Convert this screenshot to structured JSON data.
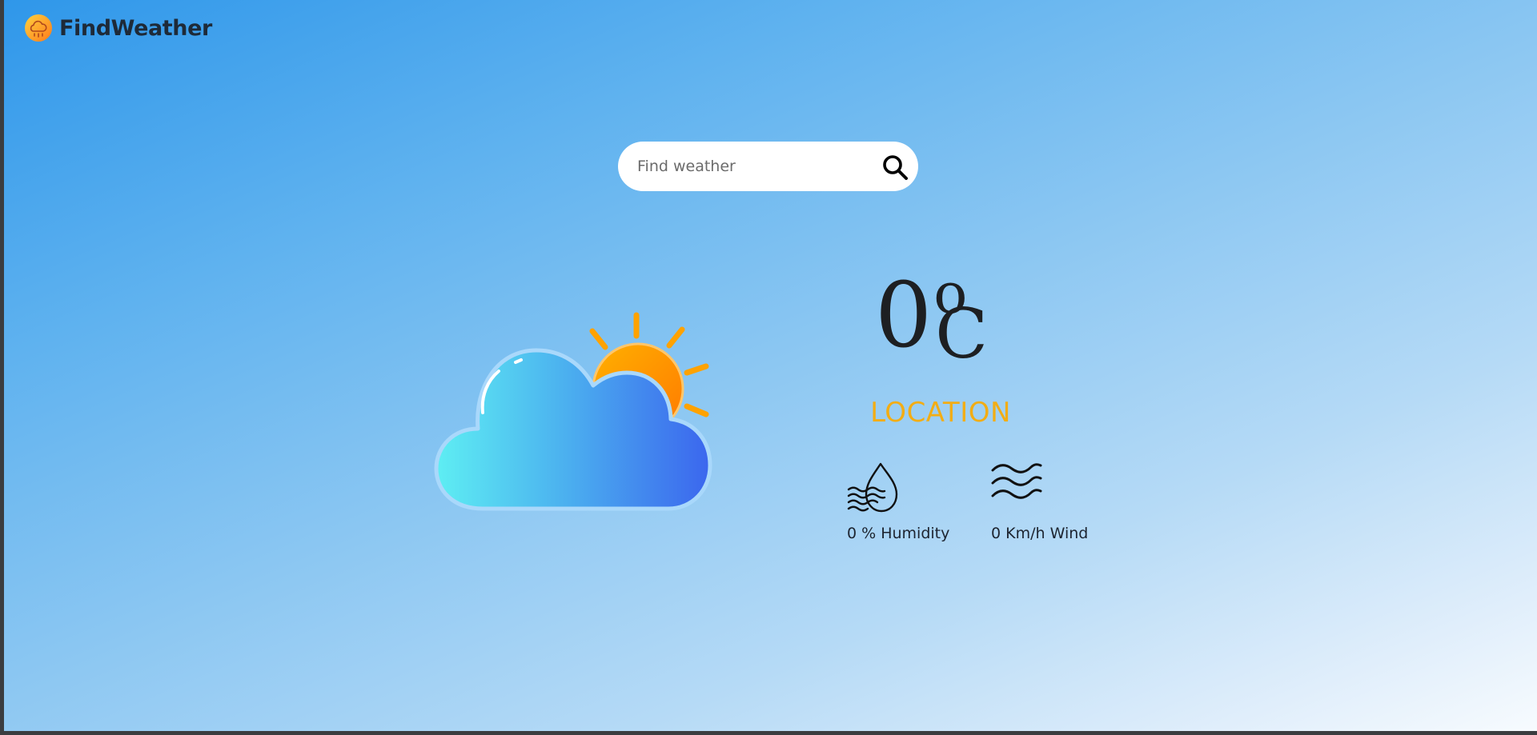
{
  "app": {
    "name": "FindWeather",
    "logo_icon": "weather-logo-icon"
  },
  "search": {
    "placeholder": "Find weather",
    "value": "",
    "button_icon": "search-icon"
  },
  "weather": {
    "illustration": "sun-behind-cloud-icon",
    "temperature": "0",
    "degree_symbol": "o",
    "unit": "C",
    "location": "LOCATION",
    "humidity_label": "0 % Humidity",
    "humidity_icon": "humidity-icon",
    "wind_label": "0 Km/h Wind",
    "wind_icon": "wind-icon"
  },
  "colors": {
    "accent_location": "#f2ad15",
    "sun": "#ff8c00",
    "cloud_light": "#5ee8f2",
    "cloud_dark": "#3c6ef0"
  }
}
